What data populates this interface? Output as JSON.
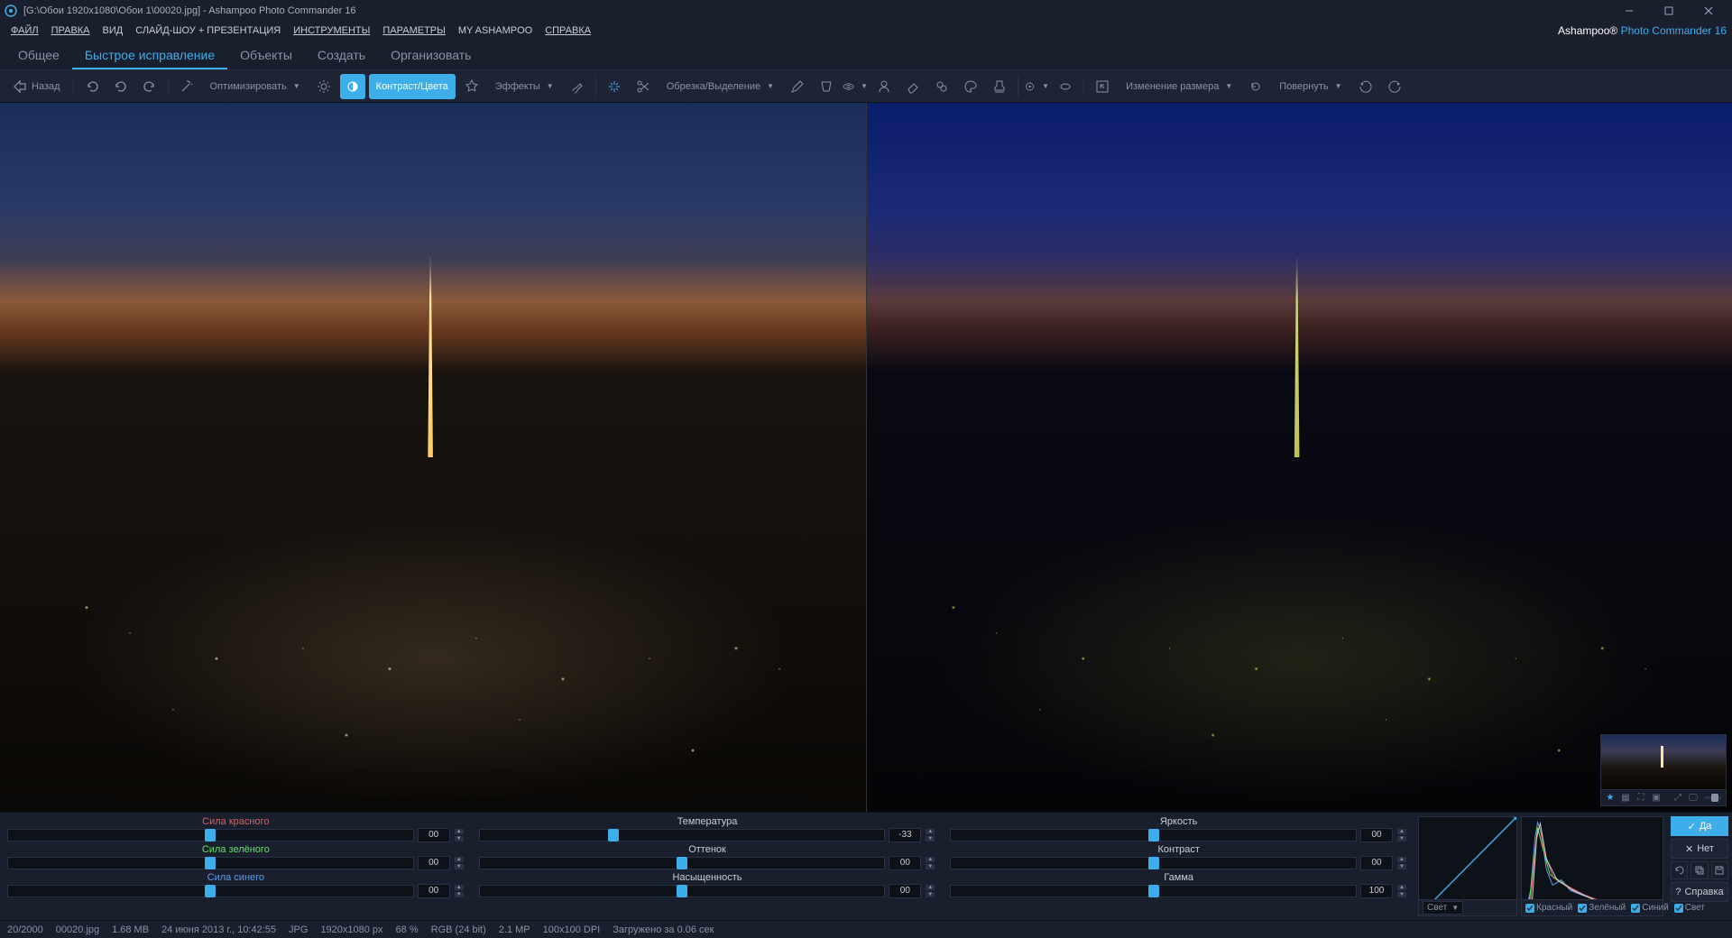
{
  "title": "[G:\\Обои 1920x1080\\Обои 1\\00020.jpg] - Ashampoo Photo Commander 16",
  "brand": {
    "a": "Ashampoo®",
    "b": "Photo Commander 16"
  },
  "menu": {
    "file": "ФАЙЛ",
    "edit": "ПРАВКА",
    "view": "ВИД",
    "slideshow": "СЛАЙД-ШОУ + ПРЕЗЕНТАЦИЯ",
    "tools": "ИНСТРУМЕНТЫ",
    "params": "ПАРАМЕТРЫ",
    "my": "MY ASHAMPOO",
    "help": "СПРАВКА"
  },
  "tabs": {
    "general": "Общее",
    "quickfix": "Быстрое исправление",
    "objects": "Объекты",
    "create": "Создать",
    "organize": "Организовать"
  },
  "toolbar": {
    "back": "Назад",
    "optimize": "Оптимизировать",
    "contrast": "Контраст/Цвета",
    "effects": "Эффекты",
    "crop": "Обрезка/Выделение",
    "resize": "Изменение размера",
    "rotate": "Повернуть"
  },
  "sliders": {
    "col1": [
      {
        "label": "Сила красного",
        "cls": "red",
        "val": "00",
        "pos": 50
      },
      {
        "label": "Сила зелёного",
        "cls": "green",
        "val": "00",
        "pos": 50
      },
      {
        "label": "Сила синего",
        "cls": "blue",
        "val": "00",
        "pos": 50
      }
    ],
    "col2": [
      {
        "label": "Температура",
        "cls": "",
        "val": "-33",
        "pos": 33
      },
      {
        "label": "Оттенок",
        "cls": "",
        "val": "00",
        "pos": 50
      },
      {
        "label": "Насыщенность",
        "cls": "",
        "val": "00",
        "pos": 50
      }
    ],
    "col3": [
      {
        "label": "Яркость",
        "cls": "",
        "val": "00",
        "pos": 50
      },
      {
        "label": "Контраст",
        "cls": "",
        "val": "00",
        "pos": 50
      },
      {
        "label": "Гамма",
        "cls": "",
        "val": "100",
        "pos": 50
      }
    ]
  },
  "histogram": {
    "mode": "Свет",
    "red": "Красный",
    "green": "Зелёный",
    "blue": "Синий",
    "light": "Свет"
  },
  "actions": {
    "yes": "Да",
    "no": "Нет",
    "help": "Справка"
  },
  "status": {
    "idx": "20/2000",
    "file": "00020.jpg",
    "size": "1.68 MB",
    "date": "24 июня 2013 г., 10:42:55",
    "fmt": "JPG",
    "dim": "1920x1080 px",
    "zoom": "68 %",
    "mode": "RGB (24 bit)",
    "mp": "2.1 MP",
    "dpi": "100x100 DPI",
    "load": "Загружено за 0.06 сек"
  }
}
